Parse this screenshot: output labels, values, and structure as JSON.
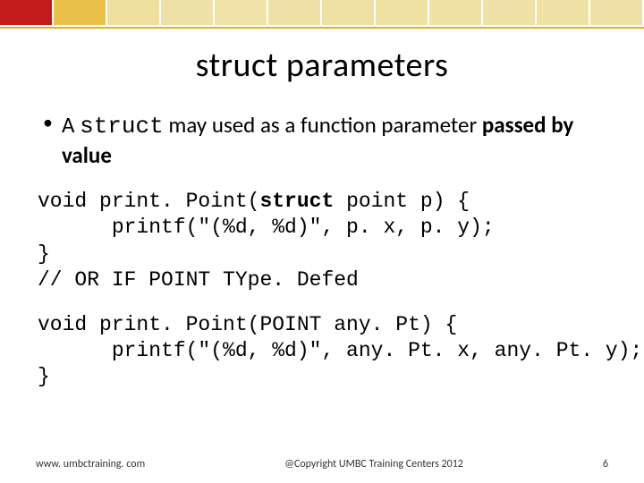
{
  "topbar_colors": [
    "#c31b1b",
    "#eac24a",
    "#efe0a0",
    "#eee1a8",
    "#f0e2a8",
    "#efe1a6",
    "#efe0a4",
    "#efe0a4",
    "#f0e1a5",
    "#f0e1a6",
    "#f0e1a6",
    "#f0e1a6"
  ],
  "title": "struct parameters",
  "bullet": {
    "prefix": "A ",
    "mono": "struct",
    "mid": " may used as a function parameter ",
    "bold_tail": "passed by value"
  },
  "code1": {
    "l1a": "void print. Point(",
    "l1b": "struct",
    "l1c": " point p) {",
    "l2": "      printf(\"(%d, %d)\", p. x, p. y);",
    "l3": "}",
    "l4": "// OR IF POINT TYpe. Defed"
  },
  "code2": {
    "l1": "void print. Point(POINT any. Pt) {",
    "l2": "      printf(\"(%d, %d)\", any. Pt. x, any. Pt. y);",
    "l3": "}"
  },
  "footer": {
    "left": "www. umbctraining. com",
    "center": "@Copyright UMBC Training Centers 2012",
    "right": "6"
  }
}
